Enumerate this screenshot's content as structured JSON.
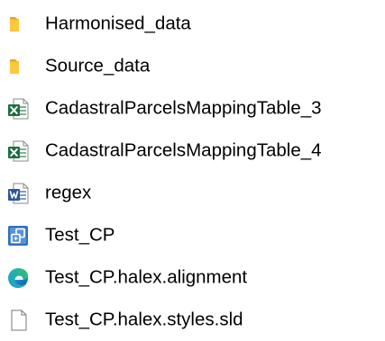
{
  "explorer": {
    "items": [
      {
        "name": "Harmonised_data",
        "icon": "folder-icon"
      },
      {
        "name": "Source_data",
        "icon": "folder-icon"
      },
      {
        "name": "CadastralParcelsMappingTable_3",
        "icon": "excel-file-icon"
      },
      {
        "name": "CadastralParcelsMappingTable_4",
        "icon": "excel-file-icon"
      },
      {
        "name": "regex",
        "icon": "word-file-icon"
      },
      {
        "name": "Test_CP",
        "icon": "hale-project-icon"
      },
      {
        "name": "Test_CP.halex.alignment",
        "icon": "edge-browser-icon"
      },
      {
        "name": "Test_CP.halex.styles.sld",
        "icon": "blank-file-icon"
      }
    ],
    "colors": {
      "folder": "#ffc83d",
      "folder_dark": "#e0a526",
      "excel": "#1d6f42",
      "word": "#2b579a",
      "hale": "#2f6fbf",
      "edge_blue": "#0c59a4",
      "edge_teal": "#2fc36b"
    }
  }
}
